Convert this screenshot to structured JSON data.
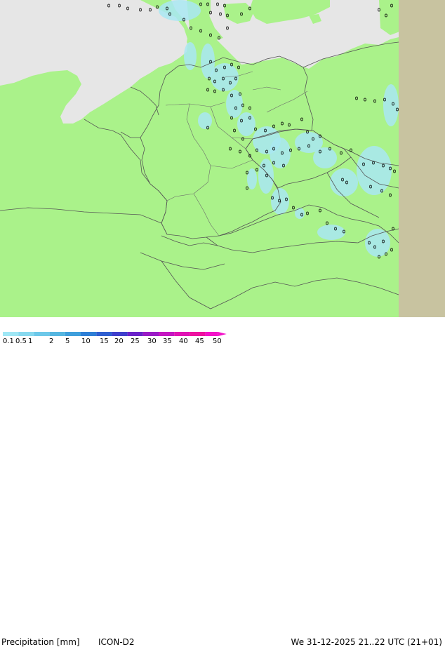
{
  "legend": {
    "title": "Precipitation [mm]",
    "model": "ICON-D2",
    "valid_time": "We 31-12-2025 21..22 UTC (21+01)",
    "ticks": [
      "0.1",
      "0.5",
      "1",
      "2",
      "5",
      "10",
      "15",
      "20",
      "25",
      "30",
      "35",
      "40",
      "45",
      "50"
    ],
    "colors": [
      "#9fe7f5",
      "#87d9ef",
      "#6dc8e9",
      "#56b6e0",
      "#3f9fdc",
      "#2e7fd6",
      "#2f5fd0",
      "#3f3fcc",
      "#6a22c9",
      "#9a1bc6",
      "#c516c2",
      "#e013b4",
      "#ee12a0",
      "#f312c8"
    ]
  },
  "map": {
    "land_color": "#aaf28a",
    "sea_color": "#e6e6e6",
    "nodata_color": "#c8c3a0",
    "precip_color": "#a9e7f2",
    "border_color": "#555555"
  }
}
